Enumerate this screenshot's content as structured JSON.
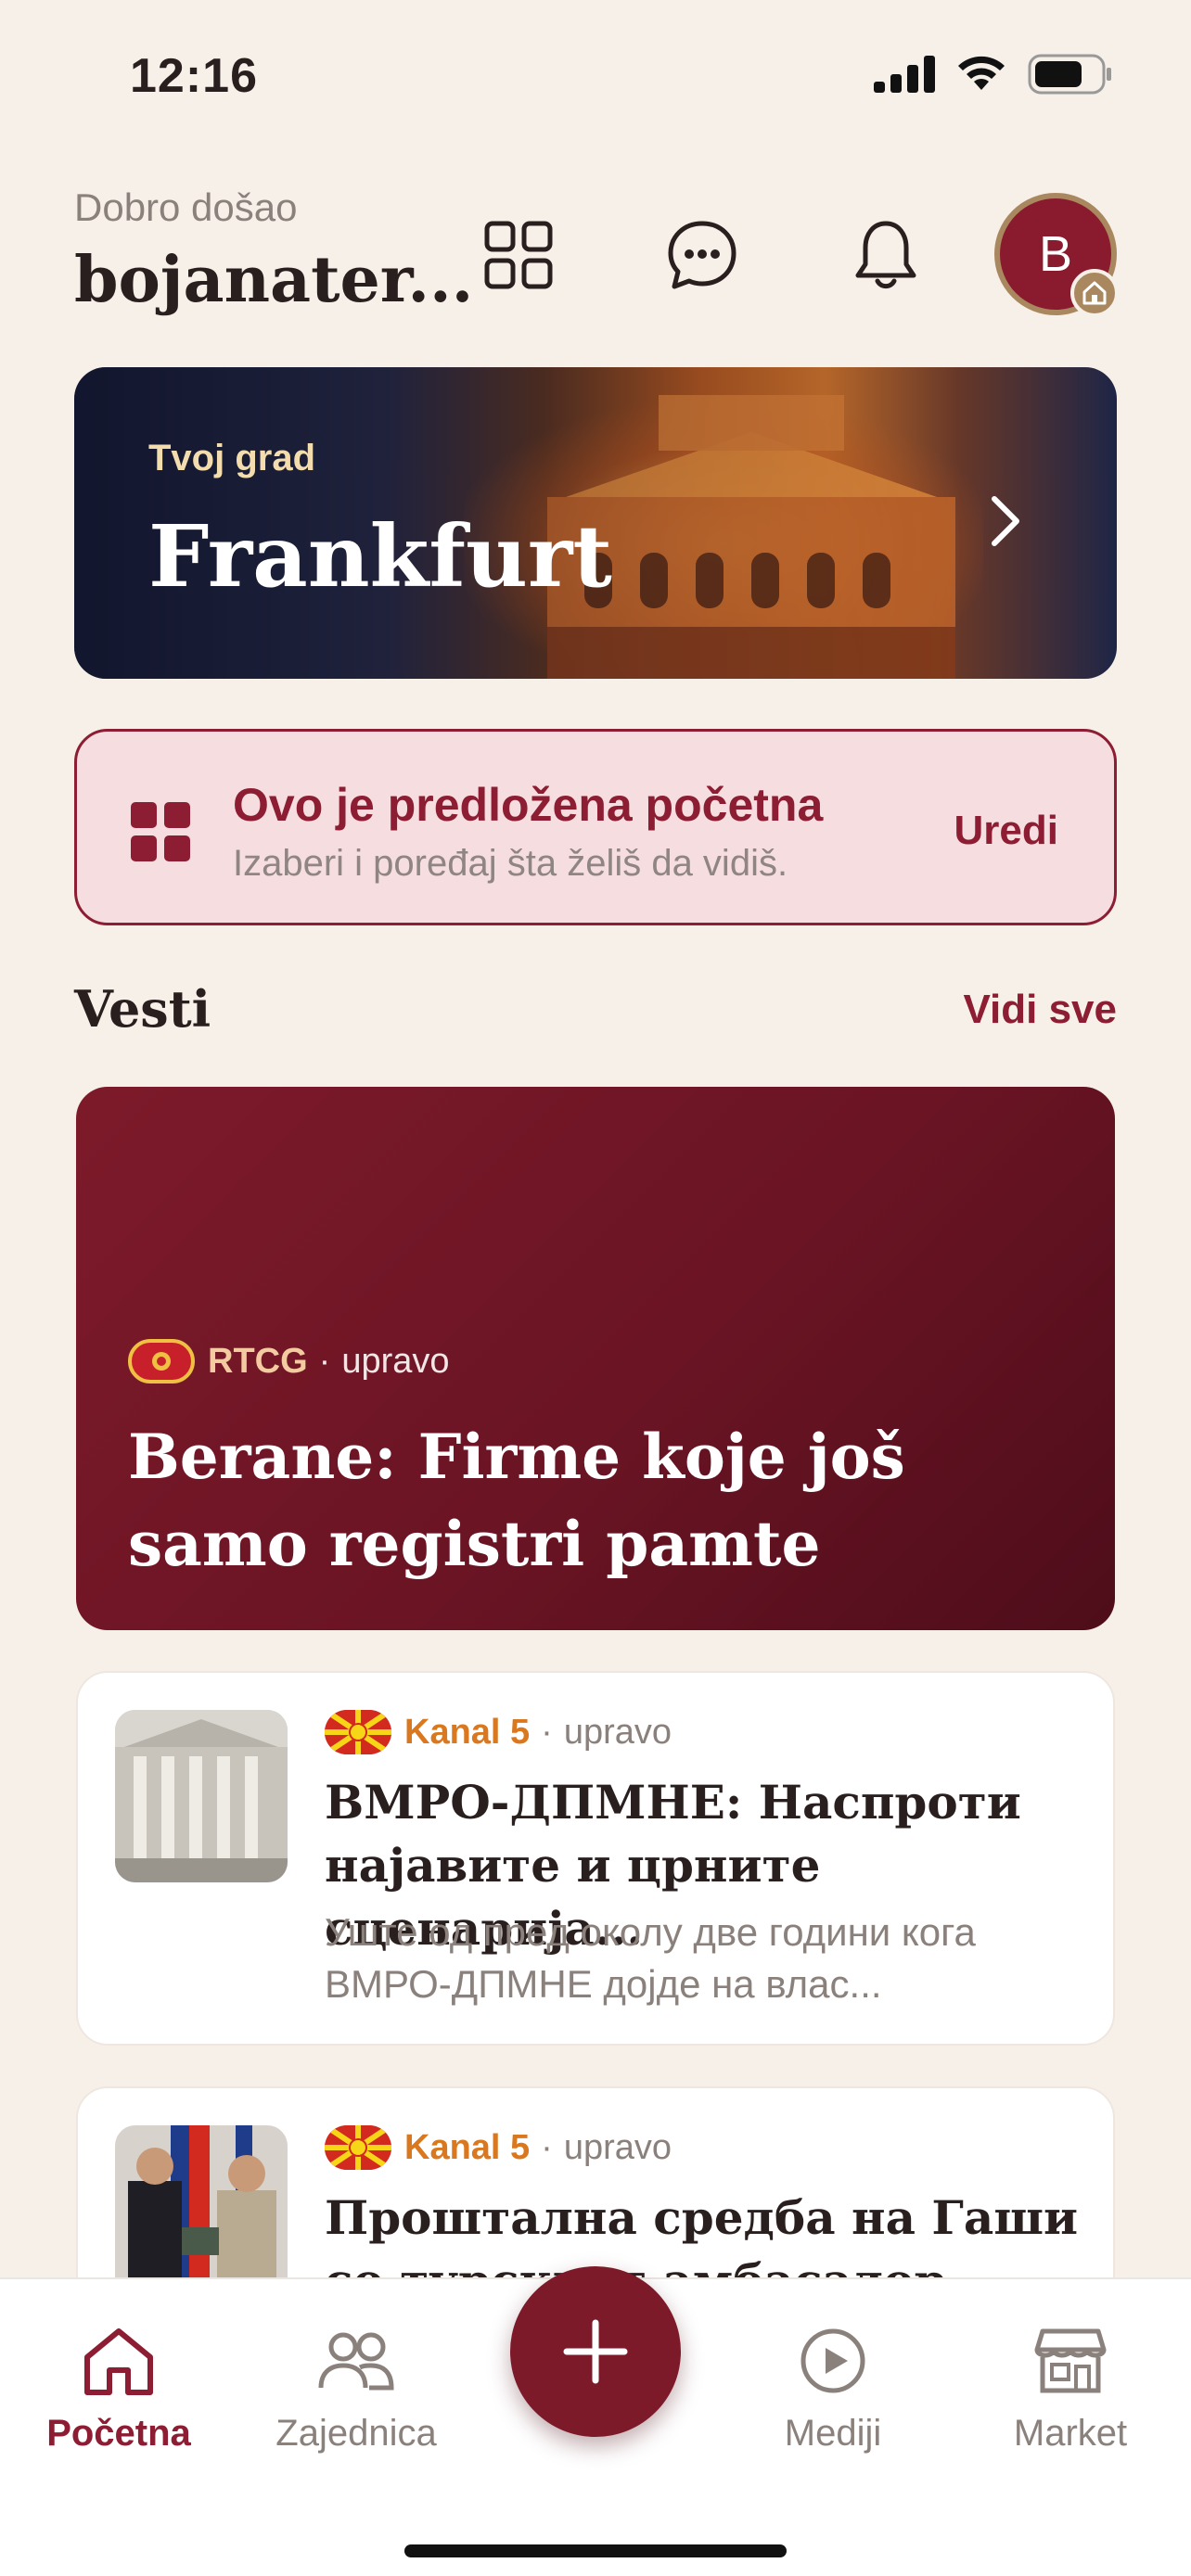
{
  "status_bar": {
    "time": "12:16"
  },
  "header": {
    "welcome": "Dobro došao",
    "username": "bojanater...",
    "avatar_initial": "B"
  },
  "city": {
    "label": "Tvoj grad",
    "name": "Frankfurt"
  },
  "suggestion": {
    "title": "Ovo je predložena početna",
    "subtitle": "Izaberi i poređaj šta želiš da vidiš.",
    "edit_label": "Uredi"
  },
  "news": {
    "section_title": "Vesti",
    "see_all": "Vidi sve",
    "featured": {
      "source": "RTCG",
      "separator": "·",
      "time": "upravo",
      "headline": "Berane: Firme koje još samo registri pamte"
    },
    "items": [
      {
        "source": "Kanal 5",
        "separator": "·",
        "time": "upravo",
        "headline": "ВМРО-ДПМНЕ: Наспроти најавите и црните сценарија...",
        "snippet": "Уште од пред околу две години кога ВМРО-ДПМНЕ дојде на влас..."
      },
      {
        "source": "Kanal 5",
        "separator": "·",
        "time": "upravo",
        "headline": "Проштална средба на Гаши со турскиот амбасадор Улусој",
        "snippet": ""
      }
    ]
  },
  "tabbar": {
    "tabs": [
      {
        "label": "Početna",
        "icon": "home-icon",
        "active": true
      },
      {
        "label": "Zajednica",
        "icon": "people-icon",
        "active": false
      },
      {
        "label": "Mediji",
        "icon": "play-icon",
        "active": false
      },
      {
        "label": "Market",
        "icon": "store-icon",
        "active": false
      }
    ],
    "fab_icon": "plus-icon"
  },
  "colors": {
    "background": "#f7f0e8",
    "brand": "#8c1d33",
    "featured_bg": "#6a1424",
    "source_accent": "#d9781e",
    "muted": "#8b817c"
  }
}
